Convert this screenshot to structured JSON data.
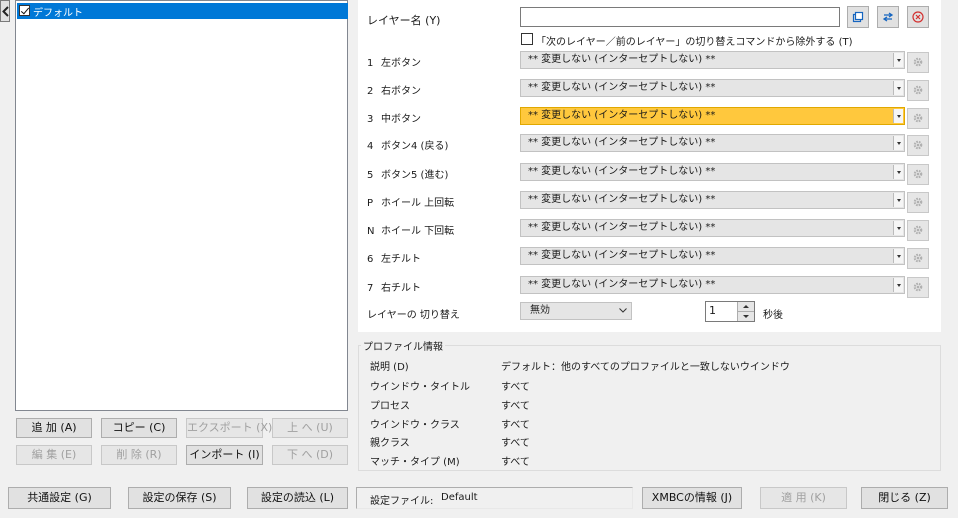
{
  "tree": {
    "items": [
      {
        "label": "デフォルト",
        "checked": true
      }
    ]
  },
  "left_buttons": {
    "add": "追 加 (A)",
    "copy": "コピー (C)",
    "export": "エクスポート (X)",
    "up": "上 へ (U)",
    "edit": "編 集 (E)",
    "delete": "削 除 (R)",
    "import": "インポート (I)",
    "down": "下 へ (D)"
  },
  "layer": {
    "name_label": "レイヤー名 (Y)",
    "name_value": "",
    "exclude_label": "「次のレイヤー／前のレイヤー」の切り替えコマンドから除外する (T)",
    "exclude_checked": false
  },
  "buttons": [
    {
      "num": "1",
      "label": "左ボタン",
      "value": "** 変更しない (インターセプトしない) **",
      "highlight": false
    },
    {
      "num": "2",
      "label": "右ボタン",
      "value": "** 変更しない (インターセプトしない) **",
      "highlight": false
    },
    {
      "num": "3",
      "label": "中ボタン",
      "value": "** 変更しない (インターセプトしない) **",
      "highlight": true
    },
    {
      "num": "4",
      "label": "ボタン4 (戻る)",
      "value": "** 変更しない (インターセプトしない) **",
      "highlight": false
    },
    {
      "num": "5",
      "label": "ボタン5 (進む)",
      "value": "** 変更しない (インターセプトしない) **",
      "highlight": false
    },
    {
      "num": "P",
      "label": "ホイール 上回転",
      "value": "** 変更しない (インターセプトしない) **",
      "highlight": false
    },
    {
      "num": "N",
      "label": "ホイール 下回転",
      "value": "** 変更しない (インターセプトしない) **",
      "highlight": false
    },
    {
      "num": "6",
      "label": "左チルト",
      "value": "** 変更しない (インターセプトしない) **",
      "highlight": false
    },
    {
      "num": "7",
      "label": "右チルト",
      "value": "** 変更しない (インターセプトしない) **",
      "highlight": false
    }
  ],
  "layer_switch": {
    "label": "レイヤーの 切り替え",
    "value": "無効",
    "seconds": "1",
    "unit": "秒後"
  },
  "profile": {
    "title": "プロファイル情報",
    "rows": [
      {
        "label": "説明 (D)",
        "value": "デフォルト：他のすべてのプロファイルと一致しないウインドウ"
      },
      {
        "label": "ウインドウ・タイトル",
        "value": "すべて"
      },
      {
        "label": "プロセス",
        "value": "すべて"
      },
      {
        "label": "ウインドウ・クラス",
        "value": "すべて"
      },
      {
        "label": "親クラス",
        "value": "すべて"
      },
      {
        "label": "マッチ・タイプ (M)",
        "value": "すべて"
      }
    ]
  },
  "bottom": {
    "common": "共通設定 (G)",
    "save": "設定の保存 (S)",
    "load": "設定の読込 (L)",
    "config_label": "設定ファイル:",
    "config_value": "Default",
    "info": "XMBCの情報 (J)",
    "apply": "適 用 (K)",
    "close": "閉じる (Z)"
  },
  "colors": {
    "selection": "#0078d7",
    "highlight": "#ffc83d",
    "panel": "#ffffff",
    "window": "#f0f0f0"
  },
  "icons": [
    "chevron-left-icon",
    "copy-icon",
    "swap-icon",
    "delete-icon",
    "gear-icon",
    "chevron-down-icon"
  ]
}
